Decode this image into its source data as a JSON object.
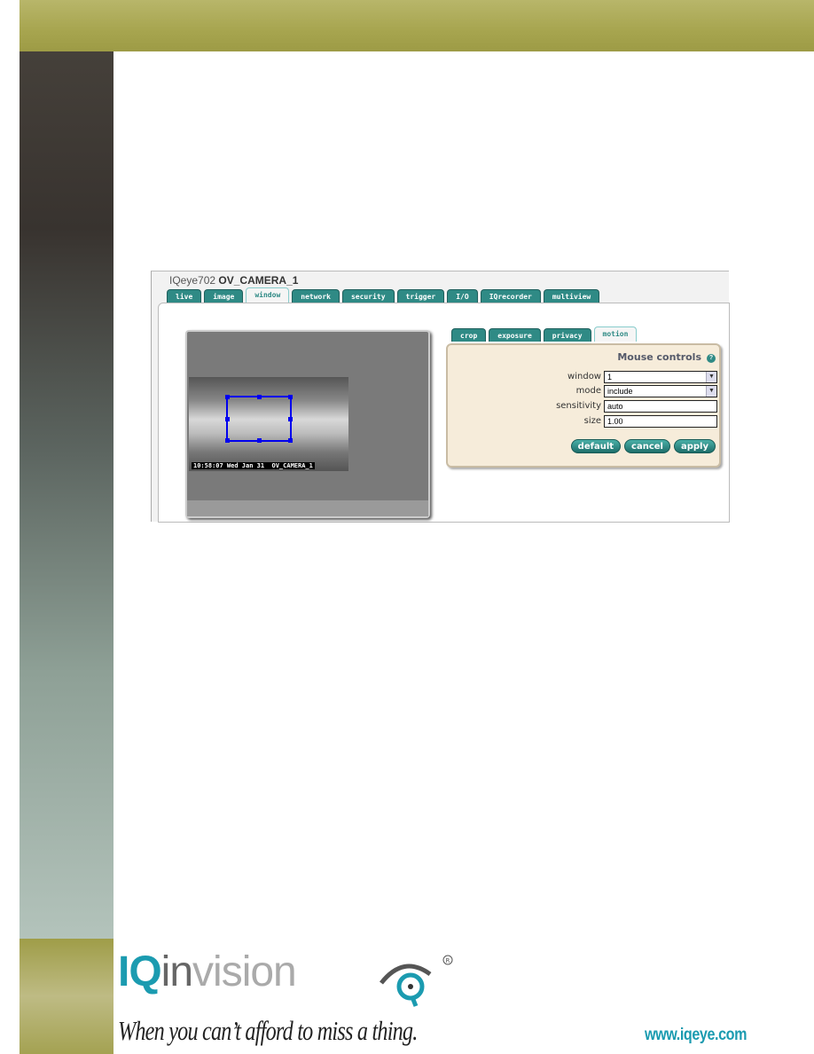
{
  "camera": {
    "model": "IQeye702",
    "name": "OV_CAMERA_1"
  },
  "tabs": [
    {
      "label": "live",
      "active": false
    },
    {
      "label": "image",
      "active": false
    },
    {
      "label": "window",
      "active": true
    },
    {
      "label": "network",
      "active": false
    },
    {
      "label": "security",
      "active": false
    },
    {
      "label": "trigger",
      "active": false
    },
    {
      "label": "I/O",
      "active": false
    },
    {
      "label": "IQrecorder",
      "active": false
    },
    {
      "label": "multiview",
      "active": false
    }
  ],
  "subtabs": [
    {
      "label": "crop",
      "active": false
    },
    {
      "label": "exposure",
      "active": false
    },
    {
      "label": "privacy",
      "active": false
    },
    {
      "label": "motion",
      "active": true
    }
  ],
  "preview": {
    "timestamp": "10:58:07 Wed Jan 31  OV_CAMERA_1"
  },
  "panel": {
    "title": "Mouse controls",
    "help_icon": "?",
    "fields": {
      "window": {
        "label": "window",
        "value": "1"
      },
      "mode": {
        "label": "mode",
        "value": "include"
      },
      "sensitivity": {
        "label": "sensitivity",
        "value": "auto"
      },
      "size": {
        "label": "size",
        "value": "1.00"
      }
    },
    "buttons": {
      "default": "default",
      "cancel": "cancel",
      "apply": "apply"
    }
  },
  "footer": {
    "logo_iq": "IQ",
    "logo_in": "in",
    "logo_vision": "vision",
    "tagline": "When you can’t afford to miss a thing.",
    "url": "www.iqeye.com"
  },
  "colors": {
    "accent": "#2f8a85",
    "brand": "#1b9bb0",
    "olive": "#a7a54f"
  }
}
